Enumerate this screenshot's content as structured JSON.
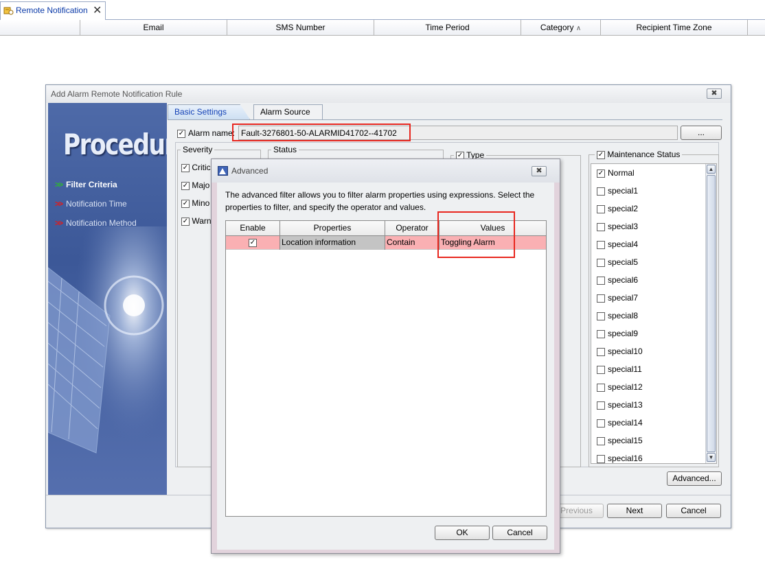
{
  "main_tab": {
    "label": "Remote Notification",
    "close": "✕"
  },
  "columns": [
    "Email",
    "SMS Number",
    "Time Period",
    "Category",
    "Recipient Time Zone"
  ],
  "category_sort": "^",
  "dialog": {
    "title": "Add Alarm Remote Notification Rule",
    "close": "✖",
    "procedure_title": "Procedure",
    "steps": [
      {
        "arrow": ">>",
        "label": "Filter Criteria",
        "color": "#2eb82e"
      },
      {
        "arrow": ">>",
        "label": "Notification Time",
        "color": "#e01b1b"
      },
      {
        "arrow": ">>",
        "label": "Notification Method",
        "color": "#e01b1b"
      }
    ],
    "tabs": [
      "Basic Settings",
      "Alarm Source"
    ],
    "alarm_name_label": "Alarm name:",
    "alarm_name_value": "Fault-3276801-50-ALARMID41702--41702",
    "browse_button": "...",
    "severity_label": "Severity",
    "severity_items": [
      "Critic",
      "Majo",
      "Mino",
      "Warn"
    ],
    "status_label": "Status",
    "type_label": "Type",
    "maintenance_label": "Maintenance Status",
    "maintenance_items": [
      {
        "label": "Normal",
        "checked": true
      },
      {
        "label": "special1",
        "checked": false
      },
      {
        "label": "special2",
        "checked": false
      },
      {
        "label": "special3",
        "checked": false
      },
      {
        "label": "special4",
        "checked": false
      },
      {
        "label": "special5",
        "checked": false
      },
      {
        "label": "special6",
        "checked": false
      },
      {
        "label": "special7",
        "checked": false
      },
      {
        "label": "special8",
        "checked": false
      },
      {
        "label": "special9",
        "checked": false
      },
      {
        "label": "special10",
        "checked": false
      },
      {
        "label": "special11",
        "checked": false
      },
      {
        "label": "special12",
        "checked": false
      },
      {
        "label": "special13",
        "checked": false
      },
      {
        "label": "special14",
        "checked": false
      },
      {
        "label": "special15",
        "checked": false
      },
      {
        "label": "special16",
        "checked": false
      }
    ],
    "advanced_button": "Advanced...",
    "previous_button": "Previous",
    "next_button": "Next",
    "cancel_button": "Cancel"
  },
  "advanced": {
    "title": "Advanced",
    "close": "✖",
    "description": "The advanced filter allows you to filter alarm properties using expressions. Select the properties to filter, and specify the operator and values.",
    "headers": [
      "Enable",
      "Properties",
      "Operator",
      "Values"
    ],
    "rows": [
      {
        "enable": true,
        "property": "Location information",
        "operator": "Contain",
        "value": "Toggling Alarm"
      }
    ],
    "ok_button": "OK",
    "cancel_button": "Cancel"
  },
  "colors": {
    "highlight_box": "#e8261e",
    "row_highlight": "#fab0b3",
    "link_blue": "#1342b6"
  }
}
